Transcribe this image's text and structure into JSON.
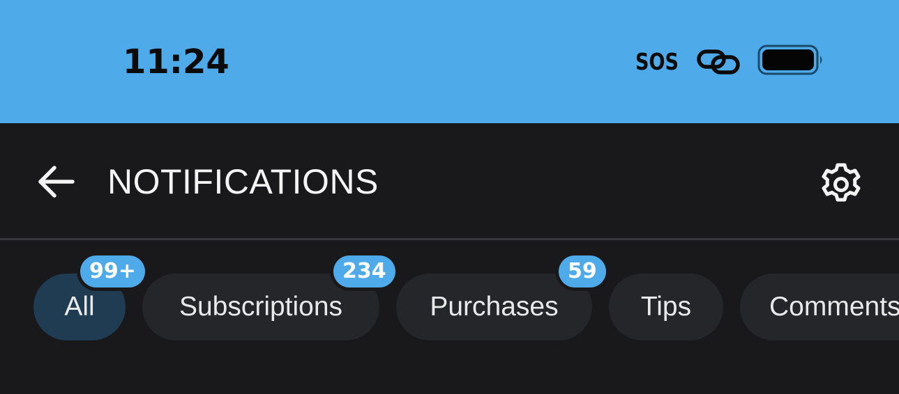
{
  "status_bar": {
    "time": "11:24",
    "sos": "SOS",
    "link_icon": "link-icon",
    "battery_icon": "battery-full-icon",
    "background_color": "#4eaae8"
  },
  "header": {
    "back_icon": "arrow-left-icon",
    "title": "NOTIFICATIONS",
    "settings_icon": "gear-icon"
  },
  "filters": {
    "chips": [
      {
        "label": "All",
        "badge": "99+",
        "active": true
      },
      {
        "label": "Subscriptions",
        "badge": "234",
        "active": false
      },
      {
        "label": "Purchases",
        "badge": "59",
        "active": false
      },
      {
        "label": "Tips",
        "badge": "",
        "active": false
      },
      {
        "label": "Comments",
        "badge": "",
        "active": false
      }
    ]
  },
  "colors": {
    "background": "#19191b",
    "chip": "#25262a",
    "chip_active": "#1f3c52",
    "accent": "#4eaae8"
  }
}
